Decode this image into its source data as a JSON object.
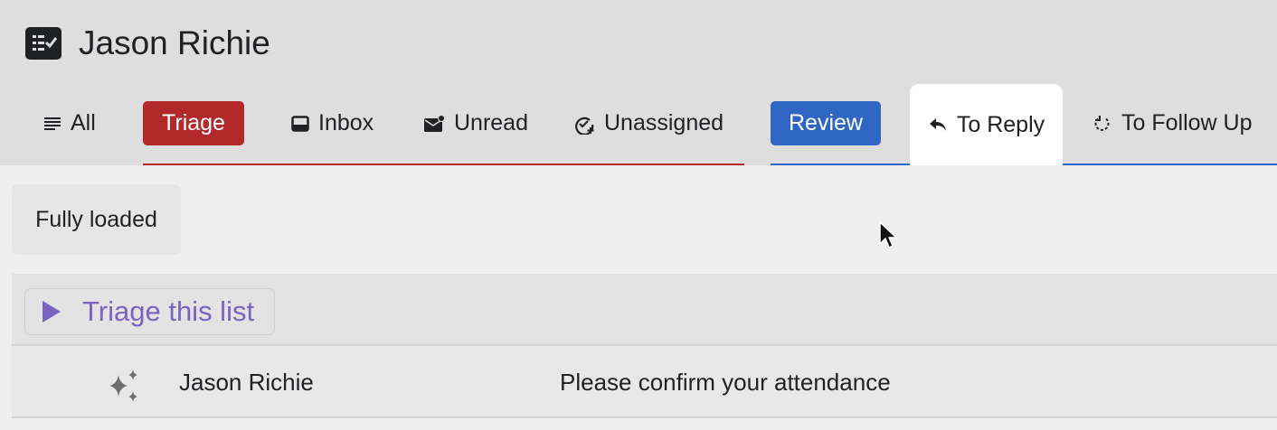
{
  "header": {
    "title": "Jason Richie",
    "icon": "checklist-icon"
  },
  "tabs": {
    "all": "All",
    "triage": "Triage",
    "inbox": "Inbox",
    "unread": "Unread",
    "unassigned": "Unassigned",
    "review": "Review",
    "to_reply": "To Reply",
    "to_follow_up": "To Follow Up"
  },
  "status": {
    "text": "Fully loaded"
  },
  "triage_action": {
    "label": "Triage this list"
  },
  "messages": [
    {
      "sender": "Jason Richie",
      "subject": "Please confirm your attendance",
      "icon": "sparkle-icon"
    }
  ],
  "colors": {
    "triage": "#b3282a",
    "review": "#2f66c3",
    "triage_action": "#7a63c2"
  }
}
